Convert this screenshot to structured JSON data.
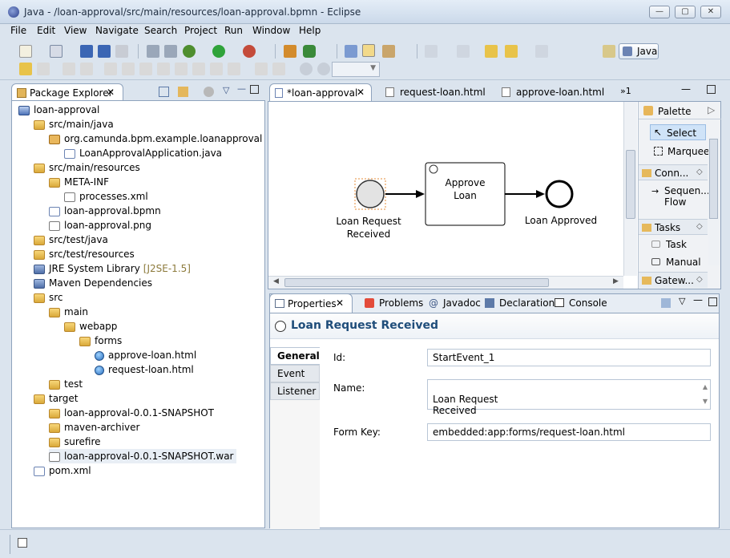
{
  "window": {
    "title": "Java - /loan-approval/src/main/resources/loan-approval.bpmn - Eclipse"
  },
  "menu": [
    "File",
    "Edit",
    "View",
    "Navigate",
    "Search",
    "Project",
    "Run",
    "Window",
    "Help"
  ],
  "perspective": {
    "label": "Java"
  },
  "package_explorer": {
    "title": "Package Explorer",
    "items": [
      {
        "label": "loan-approval",
        "type": "project",
        "depth": 0
      },
      {
        "label": "src/main/java",
        "type": "pkgfolder",
        "depth": 1
      },
      {
        "label": "org.camunda.bpm.example.loanapproval",
        "type": "package",
        "depth": 2
      },
      {
        "label": "LoanApprovalApplication.java",
        "type": "java",
        "depth": 3
      },
      {
        "label": "src/main/resources",
        "type": "pkgfolder",
        "depth": 1
      },
      {
        "label": "META-INF",
        "type": "folder",
        "depth": 2
      },
      {
        "label": "processes.xml",
        "type": "xml",
        "depth": 3
      },
      {
        "label": "loan-approval.bpmn",
        "type": "bpmn",
        "depth": 2
      },
      {
        "label": "loan-approval.png",
        "type": "png",
        "depth": 2
      },
      {
        "label": "src/test/java",
        "type": "pkgfolder",
        "depth": 1
      },
      {
        "label": "src/test/resources",
        "type": "pkgfolder",
        "depth": 1
      },
      {
        "label": "JRE System Library",
        "type": "lib",
        "depth": 1,
        "suffix": "[J2SE-1.5]"
      },
      {
        "label": "Maven Dependencies",
        "type": "lib",
        "depth": 1
      },
      {
        "label": "src",
        "type": "folder",
        "depth": 1
      },
      {
        "label": "main",
        "type": "folder",
        "depth": 2
      },
      {
        "label": "webapp",
        "type": "folder",
        "depth": 3
      },
      {
        "label": "forms",
        "type": "folder",
        "depth": 4
      },
      {
        "label": "approve-loan.html",
        "type": "html",
        "depth": 5
      },
      {
        "label": "request-loan.html",
        "type": "html",
        "depth": 5
      },
      {
        "label": "test",
        "type": "folder",
        "depth": 2
      },
      {
        "label": "target",
        "type": "folder",
        "depth": 1
      },
      {
        "label": "loan-approval-0.0.1-SNAPSHOT",
        "type": "folder",
        "depth": 2
      },
      {
        "label": "maven-archiver",
        "type": "folder",
        "depth": 2
      },
      {
        "label": "surefire",
        "type": "folder",
        "depth": 2
      },
      {
        "label": "loan-approval-0.0.1-SNAPSHOT.war",
        "type": "war",
        "depth": 2
      },
      {
        "label": "pom.xml",
        "type": "pom",
        "depth": 1
      }
    ]
  },
  "editor": {
    "tabs": [
      {
        "label": "*loan-approval",
        "active": true
      },
      {
        "label": "request-loan.html",
        "active": false
      },
      {
        "label": "approve-loan.html",
        "active": false
      }
    ],
    "overflow": "1",
    "diagram": {
      "start_event": "Loan Request\nReceived",
      "task": "Approve\nLoan",
      "end_event": "Loan Approved"
    }
  },
  "palette": {
    "title": "Palette",
    "tools": [
      "Select",
      "Marquee"
    ],
    "groups": [
      {
        "label": "Conn...",
        "items": [
          "Sequen...\nFlow"
        ]
      },
      {
        "label": "Tasks",
        "items": [
          "Task",
          "Manual"
        ]
      },
      {
        "label": "Gatew..."
      }
    ]
  },
  "bottom": {
    "tabs": [
      "Properties",
      "Problems",
      "Javadoc",
      "Declaration",
      "Console"
    ],
    "properties_title": "Loan Request Received",
    "side_tabs": [
      "General",
      "Event",
      "Listener"
    ],
    "fields": [
      {
        "label": "Id:",
        "value": "StartEvent_1"
      },
      {
        "label": "Name:",
        "value": "Loan Request\nReceived"
      },
      {
        "label": "Form Key:",
        "value": "embedded:app:forms/request-loan.html"
      }
    ]
  },
  "colors": {
    "accent": "#1f4d7a",
    "selection": "#cfe3f8",
    "task_border": "#000000",
    "start_event_fill": "#e3e3e3"
  }
}
